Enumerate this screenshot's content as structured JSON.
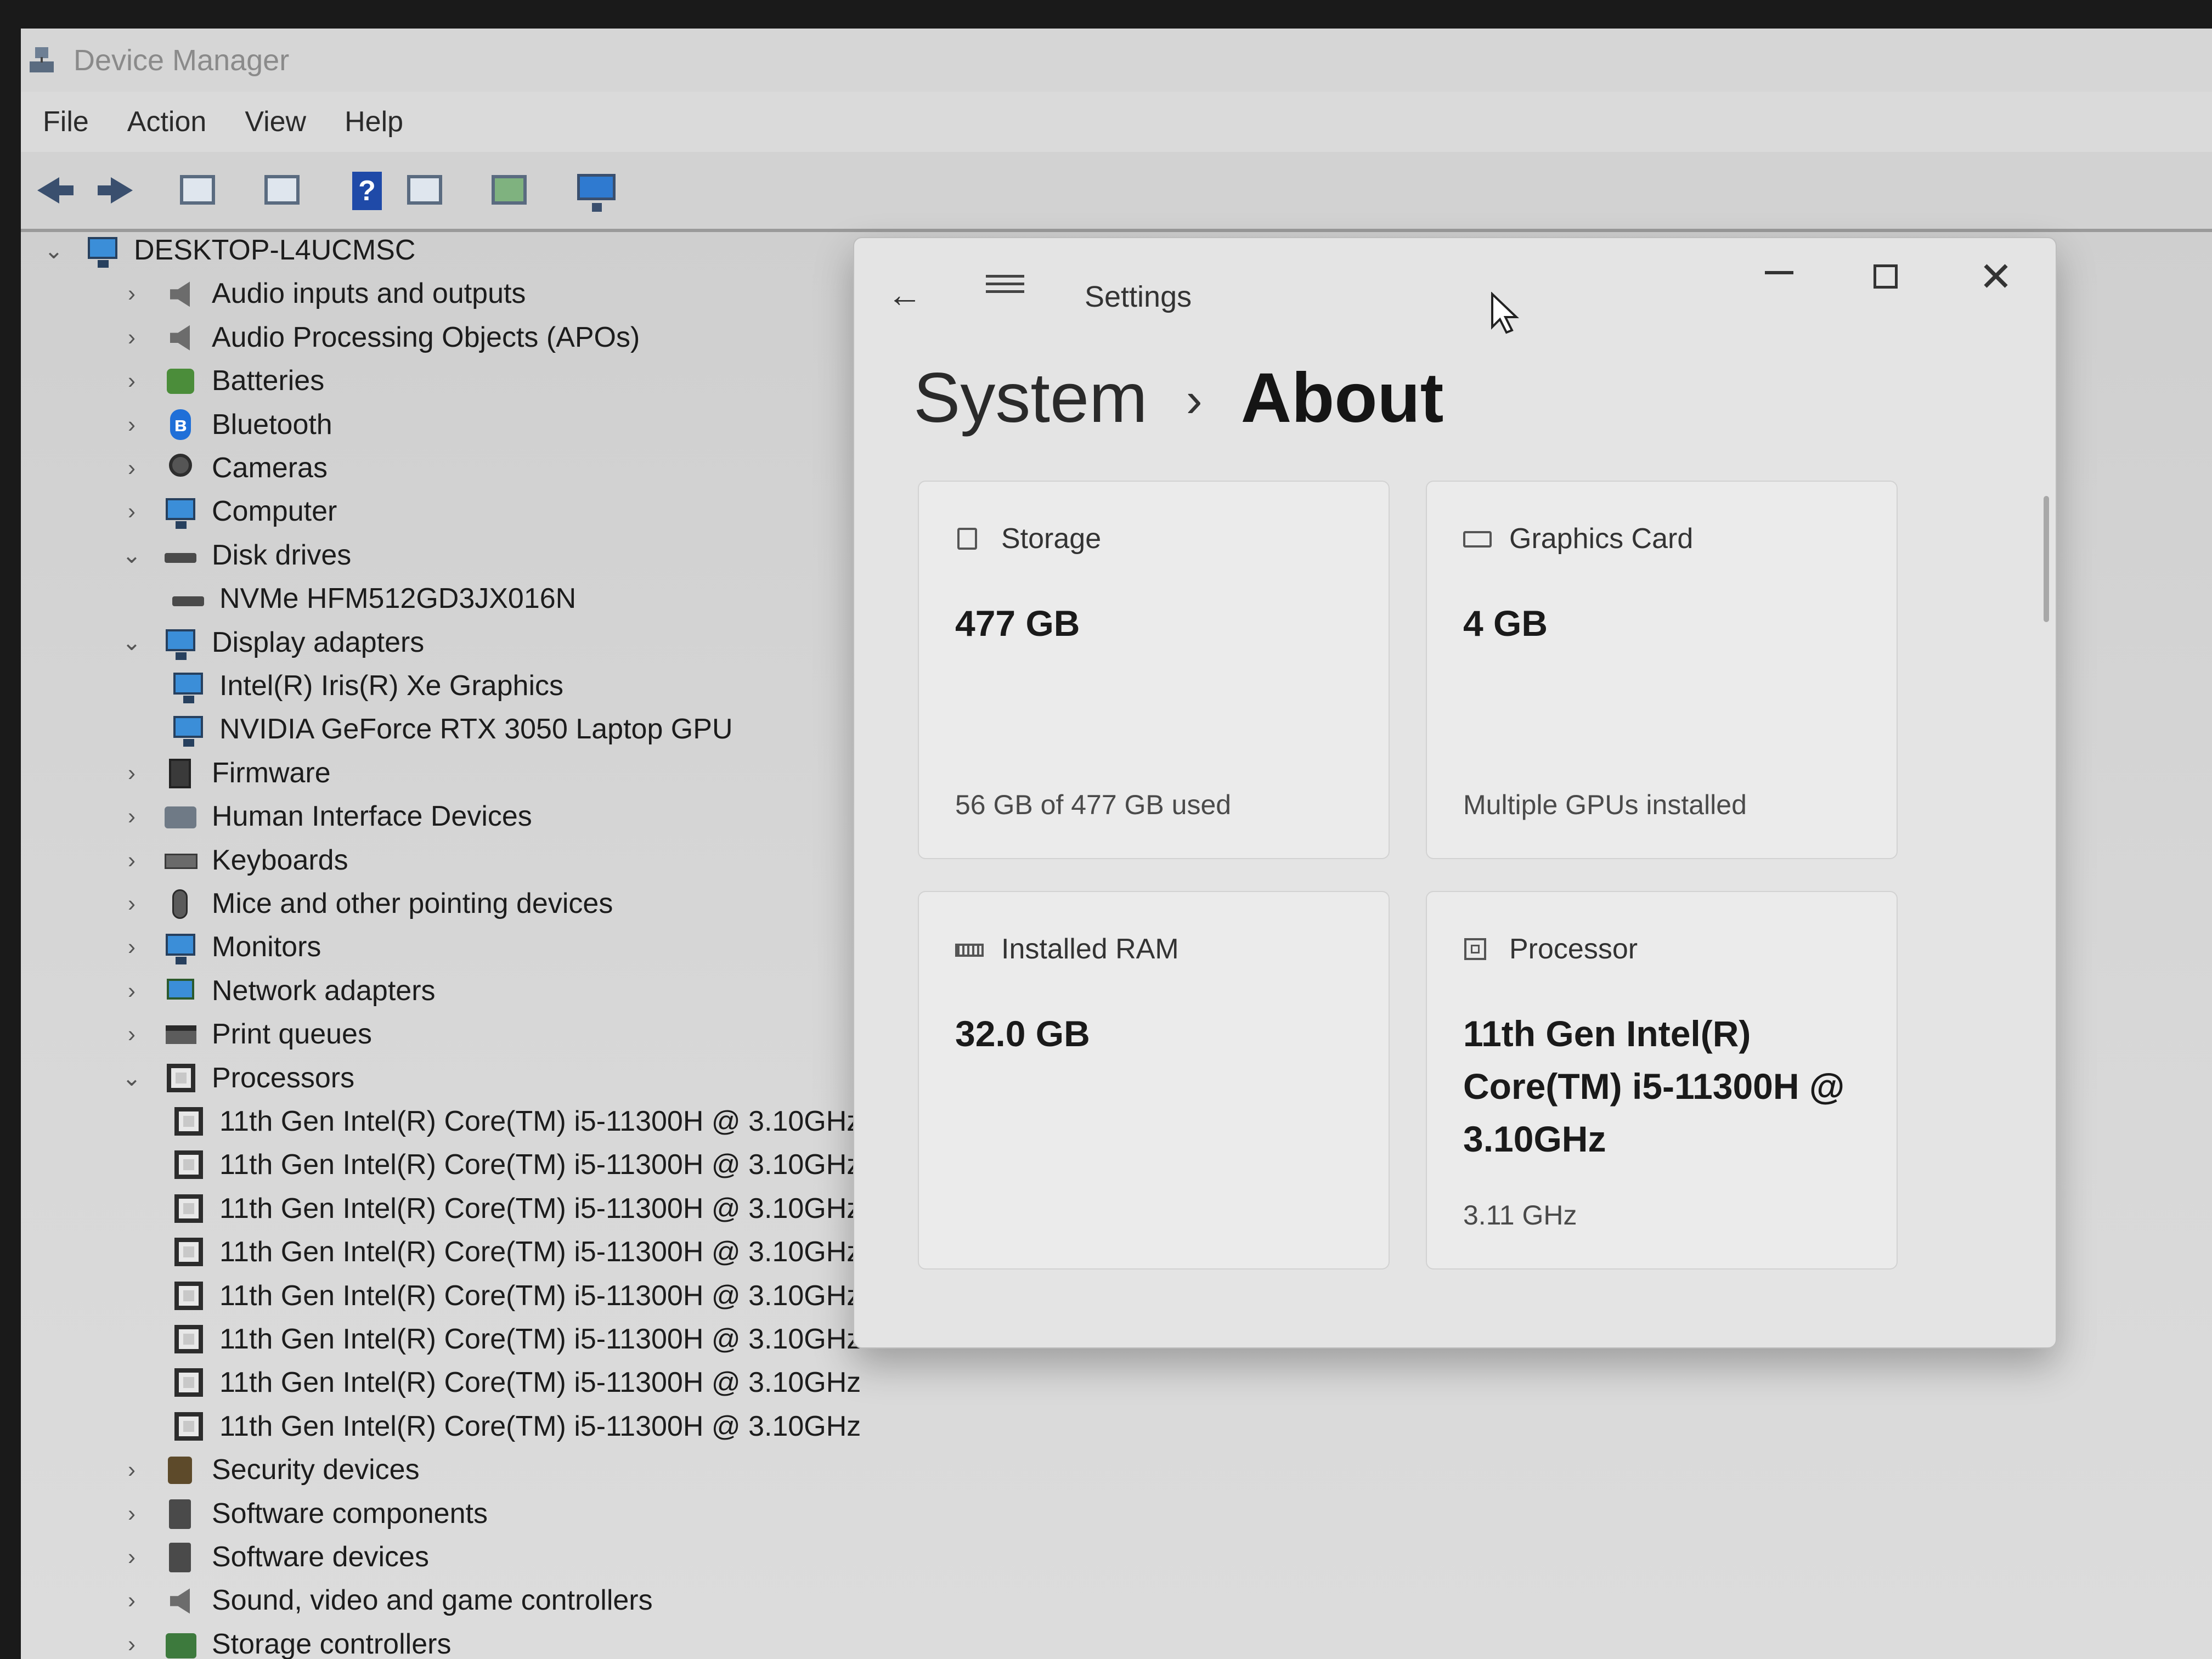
{
  "device_manager": {
    "title": "Device Manager",
    "menu": [
      "File",
      "Action",
      "View",
      "Help"
    ],
    "toolbar_icons": [
      "back-arrow-icon",
      "forward-arrow-icon",
      "properties-icon",
      "show-hidden-icon",
      "help-icon",
      "view-icon",
      "update-driver-icon",
      "monitor-icon"
    ],
    "tree": [
      {
        "label": "DESKTOP-L4UCMSC",
        "level": 0,
        "expander": "expanded",
        "icon": "computer-root-icon"
      },
      {
        "label": "Audio inputs and outputs",
        "level": 1,
        "expander": "collapsed",
        "icon": "speaker-icon"
      },
      {
        "label": "Audio Processing Objects (APOs)",
        "level": 1,
        "expander": "collapsed",
        "icon": "speaker-icon"
      },
      {
        "label": "Batteries",
        "level": 1,
        "expander": "collapsed",
        "icon": "battery-icon"
      },
      {
        "label": "Bluetooth",
        "level": 1,
        "expander": "collapsed",
        "icon": "bluetooth-icon"
      },
      {
        "label": "Cameras",
        "level": 1,
        "expander": "collapsed",
        "icon": "camera-icon"
      },
      {
        "label": "Computer",
        "level": 1,
        "expander": "collapsed",
        "icon": "computer-icon"
      },
      {
        "label": "Disk drives",
        "level": 1,
        "expander": "expanded",
        "icon": "disk-icon"
      },
      {
        "label": "NVMe HFM512GD3JX016N",
        "level": 2,
        "expander": "none",
        "icon": "disk-icon"
      },
      {
        "label": "Display adapters",
        "level": 1,
        "expander": "expanded",
        "icon": "display-adapter-icon"
      },
      {
        "label": "Intel(R) Iris(R) Xe Graphics",
        "level": 2,
        "expander": "none",
        "icon": "display-adapter-icon"
      },
      {
        "label": "NVIDIA GeForce RTX 3050 Laptop GPU",
        "level": 2,
        "expander": "none",
        "icon": "display-adapter-icon"
      },
      {
        "label": "Firmware",
        "level": 1,
        "expander": "collapsed",
        "icon": "firmware-icon"
      },
      {
        "label": "Human Interface Devices",
        "level": 1,
        "expander": "collapsed",
        "icon": "hid-icon"
      },
      {
        "label": "Keyboards",
        "level": 1,
        "expander": "collapsed",
        "icon": "keyboard-icon"
      },
      {
        "label": "Mice and other pointing devices",
        "level": 1,
        "expander": "collapsed",
        "icon": "mouse-icon"
      },
      {
        "label": "Monitors",
        "level": 1,
        "expander": "collapsed",
        "icon": "computer-icon"
      },
      {
        "label": "Network adapters",
        "level": 1,
        "expander": "collapsed",
        "icon": "network-icon"
      },
      {
        "label": "Print queues",
        "level": 1,
        "expander": "collapsed",
        "icon": "printer-icon"
      },
      {
        "label": "Processors",
        "level": 1,
        "expander": "expanded",
        "icon": "processor-icon"
      },
      {
        "label": "11th Gen Intel(R) Core(TM) i5-11300H @ 3.10GHz",
        "level": 2,
        "expander": "none",
        "icon": "processor-icon"
      },
      {
        "label": "11th Gen Intel(R) Core(TM) i5-11300H @ 3.10GHz",
        "level": 2,
        "expander": "none",
        "icon": "processor-icon"
      },
      {
        "label": "11th Gen Intel(R) Core(TM) i5-11300H @ 3.10GHz",
        "level": 2,
        "expander": "none",
        "icon": "processor-icon"
      },
      {
        "label": "11th Gen Intel(R) Core(TM) i5-11300H @ 3.10GHz",
        "level": 2,
        "expander": "none",
        "icon": "processor-icon"
      },
      {
        "label": "11th Gen Intel(R) Core(TM) i5-11300H @ 3.10GHz",
        "level": 2,
        "expander": "none",
        "icon": "processor-icon"
      },
      {
        "label": "11th Gen Intel(R) Core(TM) i5-11300H @ 3.10GHz",
        "level": 2,
        "expander": "none",
        "icon": "processor-icon"
      },
      {
        "label": "11th Gen Intel(R) Core(TM) i5-11300H @ 3.10GHz",
        "level": 2,
        "expander": "none",
        "icon": "processor-icon"
      },
      {
        "label": "11th Gen Intel(R) Core(TM) i5-11300H @ 3.10GHz",
        "level": 2,
        "expander": "none",
        "icon": "processor-icon"
      },
      {
        "label": "Security devices",
        "level": 1,
        "expander": "collapsed",
        "icon": "security-icon"
      },
      {
        "label": "Software components",
        "level": 1,
        "expander": "collapsed",
        "icon": "software-icon"
      },
      {
        "label": "Software devices",
        "level": 1,
        "expander": "collapsed",
        "icon": "software-icon"
      },
      {
        "label": "Sound, video and game controllers",
        "level": 1,
        "expander": "collapsed",
        "icon": "speaker-icon"
      },
      {
        "label": "Storage controllers",
        "level": 1,
        "expander": "collapsed",
        "icon": "storage-icon"
      }
    ]
  },
  "settings": {
    "window_title": "Settings",
    "breadcrumb_parent": "System",
    "breadcrumb_separator": "›",
    "breadcrumb_current": "About",
    "cards": [
      {
        "icon": "storage-icon",
        "title": "Storage",
        "value": "477 GB",
        "subtitle": "56 GB of 477 GB used"
      },
      {
        "icon": "graphics-card-icon",
        "title": "Graphics Card",
        "value": "4 GB",
        "subtitle": "Multiple GPUs installed"
      },
      {
        "icon": "ram-icon",
        "title": "Installed RAM",
        "value": "32.0 GB",
        "subtitle": ""
      },
      {
        "icon": "processor-icon",
        "title": "Processor",
        "value": "11th Gen Intel(R) Core(TM) i5-11300H @ 3.10GHz",
        "subtitle": "3.11 GHz"
      }
    ]
  },
  "colors": {
    "dm_background": "#d7d7d7",
    "settings_background": "#e4e4e4",
    "card_background": "#ebebeb",
    "accent_blue": "#1f6fd8"
  }
}
